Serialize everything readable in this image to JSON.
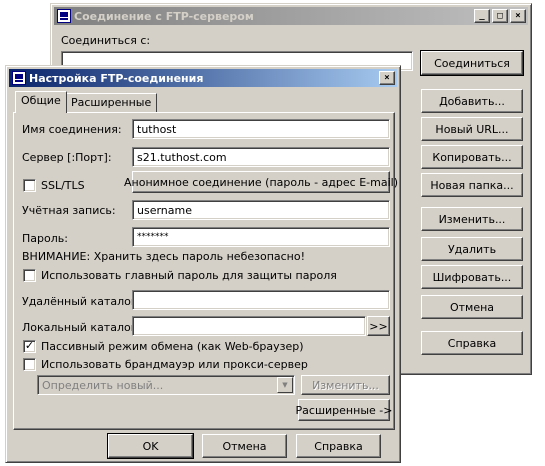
{
  "ftp_window": {
    "title": "Соединение с FTP-сервером",
    "connect_to_label": "Соединиться с:",
    "buttons": {
      "connect": "Соединиться",
      "add": "Добавить...",
      "new_url": "Новый URL...",
      "copy": "Копировать...",
      "new_folder": "Новая папка...",
      "edit": "Изменить...",
      "delete": "Удалить",
      "encrypt": "Шифровать...",
      "cancel": "Отмена",
      "help": "Справка"
    }
  },
  "dialog": {
    "title": "Настройка FTP-соединения",
    "close_glyph": "×",
    "tabs": [
      "Общие",
      "Расширенные"
    ],
    "fields": {
      "connection_name_label": "Имя соединения:",
      "connection_name_value": "tuthost",
      "server_label": "Сервер [:Порт]:",
      "server_value": "s21.tuthost.com",
      "ssl_label": "SSL/TLS",
      "anon_button": "Анонимное соединение (пароль - адрес E-mail)",
      "account_label": "Учётная запись:",
      "account_value": "username",
      "password_label": "Пароль:",
      "password_value": "*******",
      "warning": "ВНИМАНИЕ: Хранить здесь пароль небезопасно!",
      "master_password_label": "Использовать главный пароль для защиты пароля",
      "remote_dir_label": "Удалённый каталог:",
      "remote_dir_value": "",
      "local_dir_label": "Локальный каталог:",
      "local_dir_value": "",
      "browse_button": ">>",
      "passive_label": "Пассивный режим обмена (как Web-браузер)",
      "passive_checked": true,
      "firewall_label": "Использовать брандмауэр или прокси-сервер",
      "firewall_select_value": "Определить новый...",
      "firewall_edit_button": "Изменить...",
      "advanced_button": "Расширенные ->"
    },
    "buttons": {
      "ok": "OK",
      "cancel": "Отмена",
      "help": "Справка"
    }
  },
  "colors": {
    "face": "#d4d0c8",
    "active_title": "#0a246a",
    "inactive_title": "#808080"
  }
}
